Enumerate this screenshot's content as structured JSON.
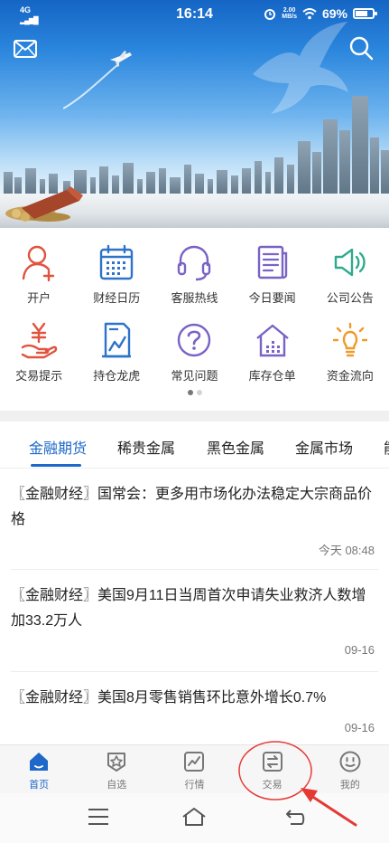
{
  "status_bar": {
    "network": "4G",
    "time": "16:14",
    "speed_top": "2.00",
    "speed_bottom": "MB/s",
    "battery": "69%"
  },
  "banner": {
    "mail_icon": "mail-icon",
    "search_icon": "search-icon"
  },
  "quick_menu": [
    {
      "label": "开户",
      "icon": "person-add-icon"
    },
    {
      "label": "财经日历",
      "icon": "calendar-icon"
    },
    {
      "label": "客服热线",
      "icon": "headset-icon"
    },
    {
      "label": "今日要闻",
      "icon": "news-icon"
    },
    {
      "label": "公司公告",
      "icon": "speaker-icon"
    },
    {
      "label": "交易提示",
      "icon": "yen-hand-icon"
    },
    {
      "label": "持仓龙虎",
      "icon": "chart-doc-icon"
    },
    {
      "label": "常见问题",
      "icon": "question-icon"
    },
    {
      "label": "库存仓单",
      "icon": "warehouse-icon"
    },
    {
      "label": "资金流向",
      "icon": "bulb-icon"
    }
  ],
  "tabs": [
    {
      "label": "金融期货",
      "active": true
    },
    {
      "label": "稀贵金属",
      "active": false
    },
    {
      "label": "黑色金属",
      "active": false
    },
    {
      "label": "金属市场",
      "active": false
    },
    {
      "label": "能",
      "active": false
    }
  ],
  "news": [
    {
      "title": "〖金融财经〗国常会：更多用市场化办法稳定大宗商品价格",
      "time": "今天 08:48"
    },
    {
      "title": "〖金融财经〗美国9月11日当周首次申请失业救济人数增加33.2万人",
      "time": "09-16"
    },
    {
      "title": "〖金融财经〗美国8月零售销售环比意外增长0.7%",
      "time": "09-16"
    }
  ],
  "bottom_nav": [
    {
      "label": "首页",
      "icon": "home-icon",
      "active": true
    },
    {
      "label": "自选",
      "icon": "star-shield-icon",
      "active": false
    },
    {
      "label": "行情",
      "icon": "trend-icon",
      "active": false
    },
    {
      "label": "交易",
      "icon": "swap-icon",
      "active": false
    },
    {
      "label": "我的",
      "icon": "smile-icon",
      "active": false
    }
  ],
  "colors": {
    "accent": "#1d68c8",
    "icon_red": "#e0533f",
    "icon_blue": "#2d73c9",
    "icon_purple": "#7a62c6",
    "icon_green": "#2faa8e",
    "icon_orange": "#f09a2a",
    "annotation_red": "#e53935"
  }
}
